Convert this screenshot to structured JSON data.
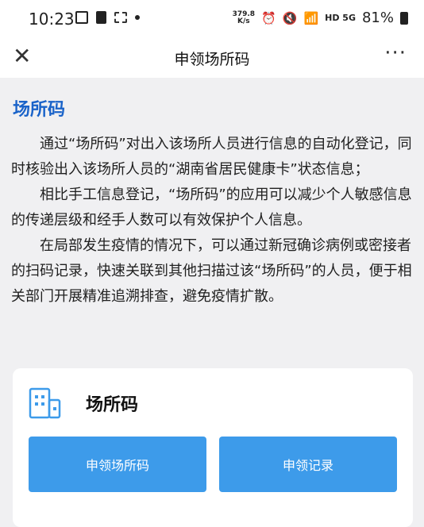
{
  "status_bar": {
    "time": "10:23",
    "speed_value": "379.8",
    "speed_unit": "K/s",
    "network": "HD 5G",
    "battery": "81%"
  },
  "nav": {
    "close_icon": "close-icon",
    "title": "申领场所码",
    "more_icon": "more-icon"
  },
  "intro": {
    "title": "场所码",
    "paragraphs": [
      "通过“场所码”对出入该场所人员进行信息的自动化登记，同时核验出入该场所人员的“湖南省居民健康卡”状态信息；",
      "相比手工信息登记，“场所码”的应用可以减少个人敏感信息的传递层级和经手人数可以有效保护个人信息。",
      "在局部发生疫情的情况下，可以通过新冠确诊病例或密接者的扫码记录，快速关联到其他扫描过该“场所码”的人员，便于相关部门开展精准追溯排查，避免疫情扩散。"
    ]
  },
  "card": {
    "icon": "building-icon",
    "title": "场所码",
    "apply_label": "申领场所码",
    "record_label": "申领记录",
    "accent_color": "#3d9bea",
    "title_color": "#1a63c9"
  }
}
